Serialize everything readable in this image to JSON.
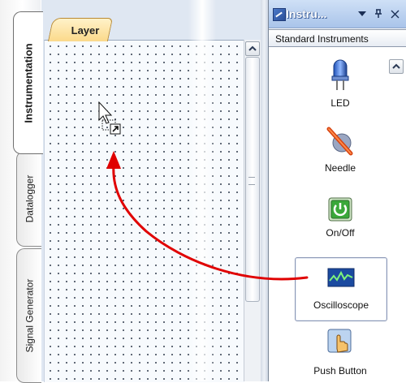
{
  "sidebar_tabs": [
    {
      "label": "Instrumentation",
      "active": true
    },
    {
      "label": "Datalogger",
      "active": false
    },
    {
      "label": "Signal Generator",
      "active": false
    }
  ],
  "canvas": {
    "layer_tab_label": "Layer"
  },
  "instruments_panel": {
    "title": "Instru...",
    "buttons": {
      "dropdown": "▼",
      "pin": "ᵖ",
      "close": "×"
    },
    "category": "Standard Instruments",
    "items": [
      {
        "label": "LED",
        "icon": "led-icon"
      },
      {
        "label": "Needle",
        "icon": "needle-icon"
      },
      {
        "label": "On/Off",
        "icon": "power-switch-icon"
      },
      {
        "label": "Oscilloscope",
        "icon": "oscilloscope-icon",
        "selected": true
      },
      {
        "label": "Push Button",
        "icon": "push-button-icon"
      }
    ]
  },
  "colors": {
    "annotation_arrow": "#e00000",
    "layer_tab": "#fbd98a",
    "panel_title": "#a9c4ea"
  }
}
